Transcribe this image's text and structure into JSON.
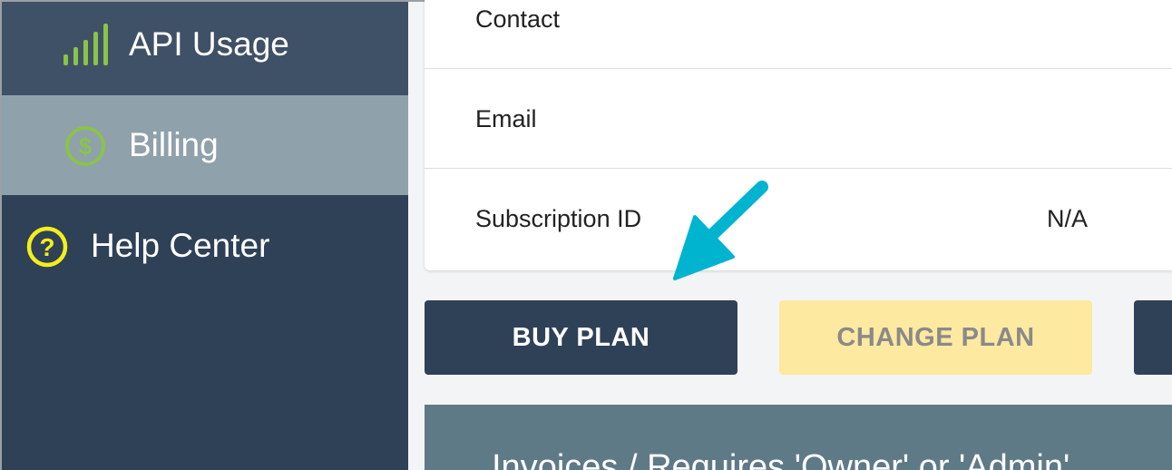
{
  "sidebar": {
    "items": [
      {
        "label": "API Usage",
        "icon": "signal-bars-icon"
      },
      {
        "label": "Billing",
        "icon": "dollar-circle-icon",
        "active": true
      },
      {
        "label": "Help Center",
        "icon": "help-circle-icon"
      }
    ]
  },
  "subscription": {
    "rows": [
      {
        "label": "Contact",
        "value": ""
      },
      {
        "label": "Email",
        "value": ""
      },
      {
        "label": "Subscription ID",
        "value": "N/A"
      }
    ]
  },
  "actions": {
    "buy_label": "BUY PLAN",
    "change_label": "CHANGE PLAN"
  },
  "invoices": {
    "title": "Invoices / Requires 'Owner' or 'Admin'"
  },
  "colors": {
    "sidebar_bg": "#2f4157",
    "active_item_bg": "#8fa1ab",
    "icon_green": "#8bc34a",
    "help_yellow": "#f5ee1a",
    "change_button_bg": "#fde9a0",
    "callout_arrow": "#00b4d0"
  }
}
